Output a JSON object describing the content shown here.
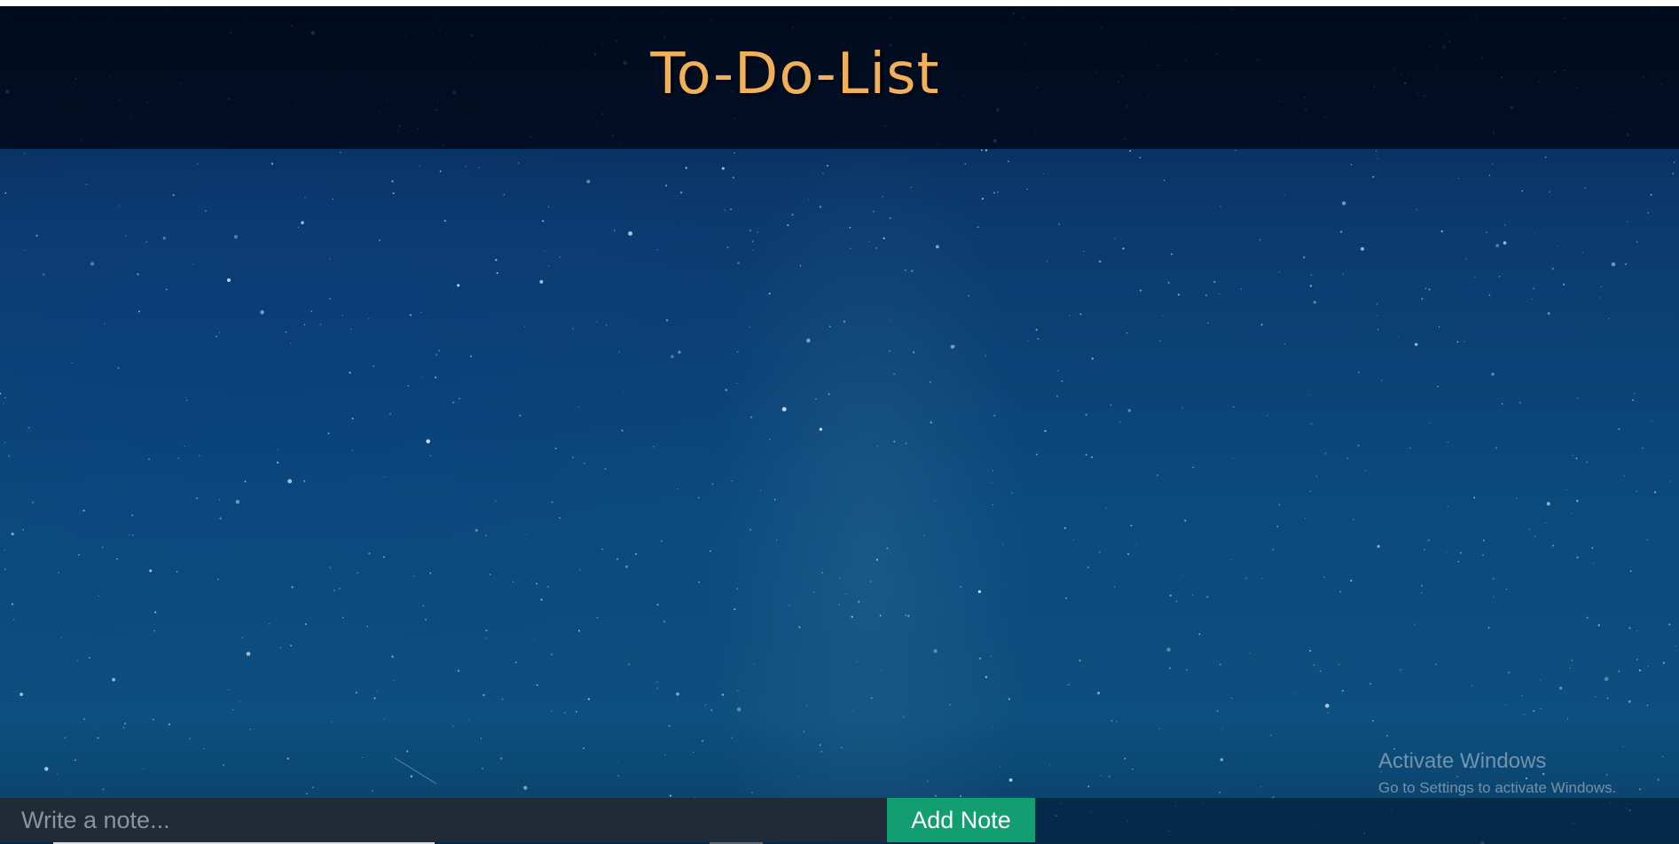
{
  "header": {
    "title": "To-Do-List"
  },
  "note_form": {
    "input_placeholder": "Write a note...",
    "input_value": "",
    "add_button_label": "Add Note"
  },
  "os_watermark": {
    "title": "Activate Windows",
    "subtitle": "Go to Settings to activate Windows."
  },
  "colors": {
    "title_color": "#f2b05a",
    "header_background": "#00060f",
    "sky_background": "#0b3f70",
    "input_background": "#202b37",
    "button_background": "#139e72",
    "button_text": "#ffffff"
  },
  "background": {
    "image_description_icon": "starry-night-sky"
  }
}
